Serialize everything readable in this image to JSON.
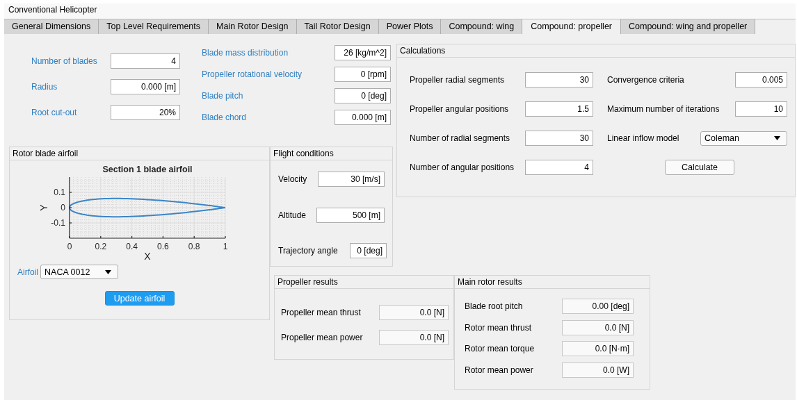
{
  "window": {
    "title": "Conventional Helicopter"
  },
  "tabs": [
    {
      "label": "General Dimensions",
      "selected": false
    },
    {
      "label": "Top Level Requirements",
      "selected": false
    },
    {
      "label": "Main Rotor Design",
      "selected": false
    },
    {
      "label": "Tail Rotor Design",
      "selected": false
    },
    {
      "label": "Power Plots",
      "selected": false
    },
    {
      "label": "Compound: wing",
      "selected": false
    },
    {
      "label": "Compound: propeller",
      "selected": true
    },
    {
      "label": "Compound: wing and propeller",
      "selected": false
    }
  ],
  "rotor_fields": [
    {
      "label": "Number of blades",
      "value": "4"
    },
    {
      "label": "Radius",
      "value": "0.000 [m]"
    },
    {
      "label": "Root cut-out",
      "value": "20%"
    }
  ],
  "blade_fields": [
    {
      "label": "Blade mass distribution",
      "value": "26 [kg/m^2]"
    },
    {
      "label": "Propeller rotational velocity",
      "value": "0 [rpm]"
    },
    {
      "label": "Blade pitch",
      "value": "0 [deg]"
    },
    {
      "label": "Blade chord",
      "value": "0.000 [m]"
    }
  ],
  "calculations": {
    "title": "Calculations",
    "left_fields": [
      {
        "label": "Propeller radial segments",
        "value": "30"
      },
      {
        "label": "Propeller angular positions",
        "value": "1.5"
      },
      {
        "label": "Number of radial segments",
        "value": "30"
      },
      {
        "label": "Number of angular positions",
        "value": "4"
      }
    ],
    "right_items": [
      {
        "kind": "input",
        "label": "Convergence criteria",
        "value": "0.005"
      },
      {
        "kind": "input",
        "label": "Maximum number of iterations",
        "value": "10"
      },
      {
        "kind": "dropdown",
        "label": "Linear inflow model",
        "value": "Coleman"
      },
      {
        "kind": "button",
        "label": "Calculate"
      }
    ]
  },
  "airfoil_panel": {
    "title": "Rotor blade airfoil",
    "chart_data": {
      "type": "line",
      "title": "Section 1 blade airfoil",
      "xlabel": "X",
      "ylabel": "Y",
      "grid": true,
      "xlim": [
        0,
        1
      ],
      "ylim": [
        -0.2,
        0.2
      ],
      "xticks": [
        0,
        0.2,
        0.4,
        0.6,
        0.8,
        1
      ],
      "yticks": [
        -0.1,
        0,
        0.1
      ]
    },
    "airfoil_label": "Airfoil",
    "airfoil_value": "NACA 0012",
    "button": "Update airfoil"
  },
  "flight_conditions": {
    "title": "Flight conditions",
    "fields": [
      {
        "label": "Velocity",
        "value": "30 [m/s]"
      },
      {
        "label": "Altitude",
        "value": "500 [m]"
      },
      {
        "label": "Trajectory angle",
        "value": "0 [deg]"
      }
    ]
  },
  "propeller_results": {
    "title": "Propeller results",
    "fields": [
      {
        "label": "Propeller mean thrust",
        "value": "0.0 [N]"
      },
      {
        "label": "Propeller mean power",
        "value": "0.0 [N]"
      }
    ]
  },
  "main_rotor_results": {
    "title": "Main rotor results",
    "fields": [
      {
        "label": "Blade root pitch",
        "value": "0.00 [deg]"
      },
      {
        "label": "Rotor mean thrust",
        "value": "0.0 [N]"
      },
      {
        "label": "Rotor mean torque",
        "value": "0.0 [N·m]"
      },
      {
        "label": "Rotor mean power",
        "value": "0.0 [W]"
      }
    ]
  }
}
